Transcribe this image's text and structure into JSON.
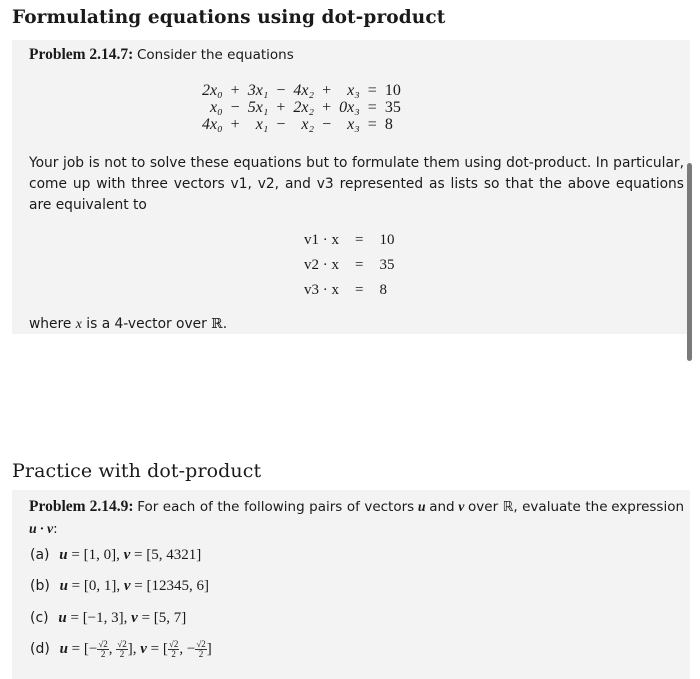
{
  "section1": {
    "heading": "Formulating equations using dot-product",
    "problem_label": "Problem 2.14.7:",
    "problem_intro": "Consider the equations",
    "equations": [
      [
        "2x₀",
        "+",
        "3x₁",
        "−",
        "4x₂",
        "+",
        "x₃",
        "=",
        "10"
      ],
      [
        "x₀",
        "−",
        "5x₁",
        "+",
        "2x₂",
        "+",
        "0x₃",
        "=",
        "35"
      ],
      [
        "4x₀",
        "+",
        "x₁",
        "−",
        "x₂",
        "−",
        "x₃",
        "=",
        "8"
      ]
    ],
    "paragraph": "Your job is not to solve these equations but to formulate them using dot-product. In particular, come up with three vectors v1, v2, and v3 represented as lists so that the above equations are equivalent to",
    "dot_equations": [
      {
        "lhs": "v1 · x",
        "eq": "=",
        "rhs": "10"
      },
      {
        "lhs": "v2 · x",
        "eq": "=",
        "rhs": "35"
      },
      {
        "lhs": "v3 · x",
        "eq": "=",
        "rhs": "8"
      }
    ],
    "footer_pre": "where",
    "footer_var": "x",
    "footer_mid": "is a 4-vector over",
    "footer_field": "ℝ",
    "footer_end": "."
  },
  "section2": {
    "heading": "Practice with dot-product",
    "problem_label": "Problem 2.14.9:",
    "problem_text_1": "For each of the following pairs of vectors",
    "var_u": "u",
    "and": "and",
    "var_v": "v",
    "problem_text_2": "over ℝ, evaluate the",
    "problem_text_3": "expression",
    "expr": "u · v",
    "colon": ":",
    "items": [
      {
        "label": "(a)",
        "u": "[1, 0]",
        "v": "[5, 4321]"
      },
      {
        "label": "(b)",
        "u": "[0, 1]",
        "v": "[12345, 6]"
      },
      {
        "label": "(c)",
        "u": "[−1, 3]",
        "v": "[5, 7]"
      },
      {
        "label": "(d)",
        "u_parts": [
          "[−",
          "√2",
          "2",
          ", ",
          "√2",
          "2",
          "]"
        ],
        "v_parts": [
          "[",
          "√2",
          "2",
          ", −",
          "√2",
          "2",
          "]"
        ]
      }
    ]
  },
  "colors": {
    "box_background": "#f3f3f3",
    "scrollbar": "#7a7a7a",
    "text": "#1a1a1a"
  }
}
